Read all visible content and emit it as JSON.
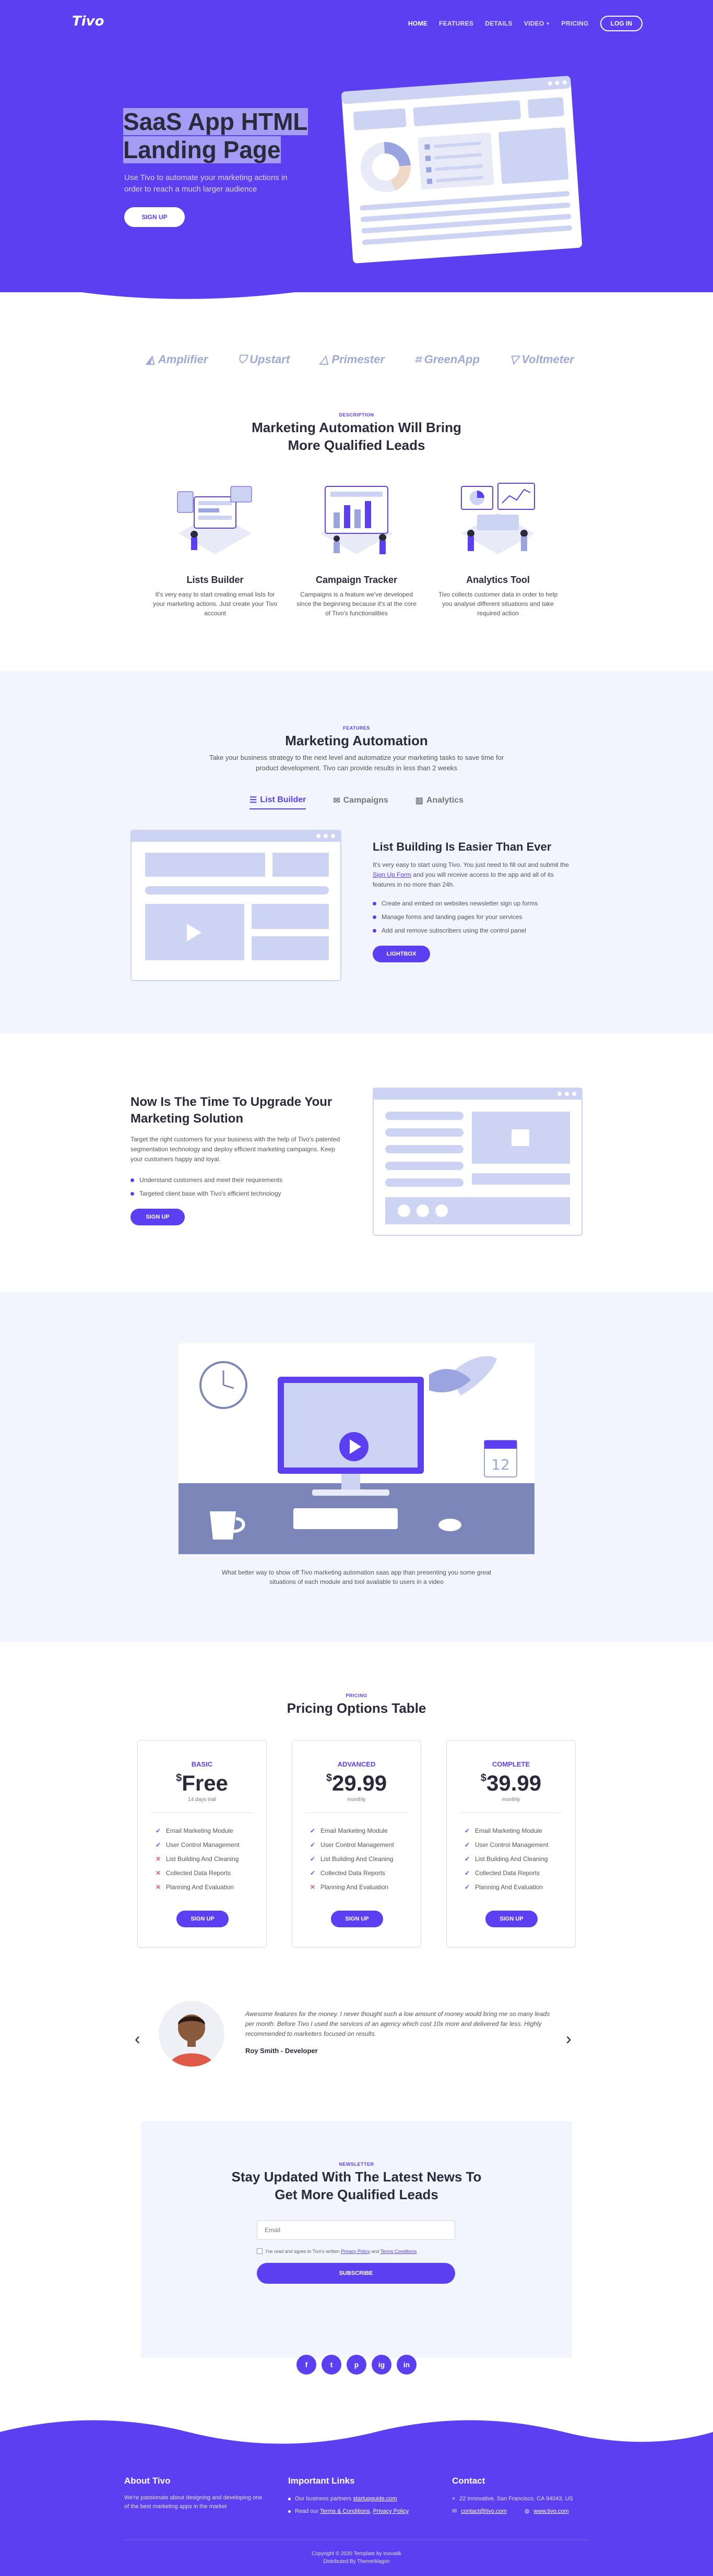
{
  "colors": {
    "primary": "#5b3ff0",
    "light_bg": "#f2f4fe",
    "heading": "#2a2a3c"
  },
  "nav": {
    "logo": "Tivo",
    "links": [
      "HOME",
      "FEATURES",
      "DETAILS",
      "VIDEO",
      "PRICING"
    ],
    "login": "LOG IN"
  },
  "hero": {
    "title": "SaaS App HTML Landing Page",
    "subtitle": "Use Tivo to automate your marketing actions in order to reach a much larger audience",
    "button": "SIGN UP"
  },
  "clients": [
    "Amplifier",
    "Upstart",
    "Primester",
    "GreenApp",
    "Voltmeter"
  ],
  "description": {
    "eyebrow": "DESCRIPTION",
    "title": "Marketing Automation Will Bring More Qualified Leads",
    "features": [
      {
        "title": "Lists Builder",
        "text": "It's very easy to start creating email lists for your marketing actions. Just create your Tivo account"
      },
      {
        "title": "Campaign Tracker",
        "text": "Campaigns is a feature we've developed since the beginning because it's at the core of Tivo's functionalities"
      },
      {
        "title": "Analytics Tool",
        "text": "Tivo collects customer data in order to help you analyse different situations and take required action"
      }
    ]
  },
  "features": {
    "eyebrow": "FEATURES",
    "title": "Marketing Automation",
    "subtitle": "Take your business strategy to the next level and automatize your marketing tasks to save time for product development. Tivo can provide results in less than 2 weeks",
    "tabs": [
      "List Builder",
      "Campaigns",
      "Analytics"
    ],
    "panel": {
      "title": "List Building Is Easier Than Ever",
      "text_before": "It's very easy to start using Tivo. You just need to fill out and submit the ",
      "link": "Sign Up Form",
      "text_after": " and you will receive access to the app and all of its features in no more than 24h.",
      "bullets": [
        "Create and embed on websites newsletter sign up forms",
        "Manage forms and landing pages for your services",
        "Add and remove subscribers using the control panel"
      ],
      "button": "LIGHTBOX"
    }
  },
  "upgrade": {
    "title": "Now Is The Time To Upgrade Your Marketing Solution",
    "text": "Target the right customers for your business with the help of Tivo's patented segmentation technology and deploy efficient marketing campaigns. Keep your customers happy and loyal.",
    "bullets": [
      "Understand customers and meet their requirements",
      "Targeted client base with Tivo's efficient technology"
    ],
    "button": "SIGN UP"
  },
  "video": {
    "caption": "What better way to show off Tivo marketing automation saas app than presenting you some great situations of each module and tool available to users in a video",
    "calendar_day": "12"
  },
  "pricing": {
    "eyebrow": "PRICING",
    "title": "Pricing Options Table",
    "plans": [
      {
        "name": "BASIC",
        "currency": "$",
        "price": "Free",
        "period": "14 days trial",
        "items": [
          {
            "label": "Email Marketing Module",
            "included": true
          },
          {
            "label": "User Control Management",
            "included": true
          },
          {
            "label": "List Building And Cleaning",
            "included": false
          },
          {
            "label": "Collected Data Reports",
            "included": false
          },
          {
            "label": "Planning And Evaluation",
            "included": false
          }
        ],
        "button": "SIGN UP"
      },
      {
        "name": "ADVANCED",
        "currency": "$",
        "price": "29.99",
        "period": "monthly",
        "items": [
          {
            "label": "Email Marketing Module",
            "included": true
          },
          {
            "label": "User Control Management",
            "included": true
          },
          {
            "label": "List Building And Cleaning",
            "included": true
          },
          {
            "label": "Collected Data Reports",
            "included": true
          },
          {
            "label": "Planning And Evaluation",
            "included": false
          }
        ],
        "button": "SIGN UP"
      },
      {
        "name": "COMPLETE",
        "currency": "$",
        "price": "39.99",
        "period": "monthly",
        "items": [
          {
            "label": "Email Marketing Module",
            "included": true
          },
          {
            "label": "User Control Management",
            "included": true
          },
          {
            "label": "List Building And Cleaning",
            "included": true
          },
          {
            "label": "Collected Data Reports",
            "included": true
          },
          {
            "label": "Planning And Evaluation",
            "included": true
          }
        ],
        "button": "SIGN UP"
      }
    ]
  },
  "testimonial": {
    "quote": "Awesome features for the money. I never thought such a low amount of money would bring me so many leads per month. Before Tivo I used the services of an agency which cost 10x more and delivered far less. Highly recommended to marketers focused on results.",
    "author": "Roy Smith - Developer"
  },
  "newsletter": {
    "eyebrow": "NEWSLETTER",
    "title": "Stay Updated With The Latest News To Get More Qualified Leads",
    "email_placeholder": "Email",
    "consent_prefix": "I've read and agree to Tivo's written ",
    "privacy": "Privacy Policy",
    "consent_mid": " and ",
    "terms": "Terms Conditions",
    "button": "SUBSCRIBE"
  },
  "socials": [
    "f",
    "t",
    "p",
    "ig",
    "in"
  ],
  "footer": {
    "about_title": "About Tivo",
    "about_text": "We're passionate about designing and developing one of the best marketing apps in the market",
    "links_title": "Important Links",
    "links_1_prefix": "Our business partners ",
    "links_1_link": "startupguide.com",
    "links_2_prefix": "Read our ",
    "links_2_link_a": "Terms & Conditions",
    "links_2_sep": ", ",
    "links_2_link_b": "Privacy Policy",
    "contact_title": "Contact",
    "address": "22 Innovative, San Francisco, CA 94043, US",
    "email": "contact@tivo.com",
    "website": "www.tivo.com",
    "copyright": "Copyright © 2020 Template by Inovatik",
    "distributed": "Distributed By ThemeWagon"
  }
}
